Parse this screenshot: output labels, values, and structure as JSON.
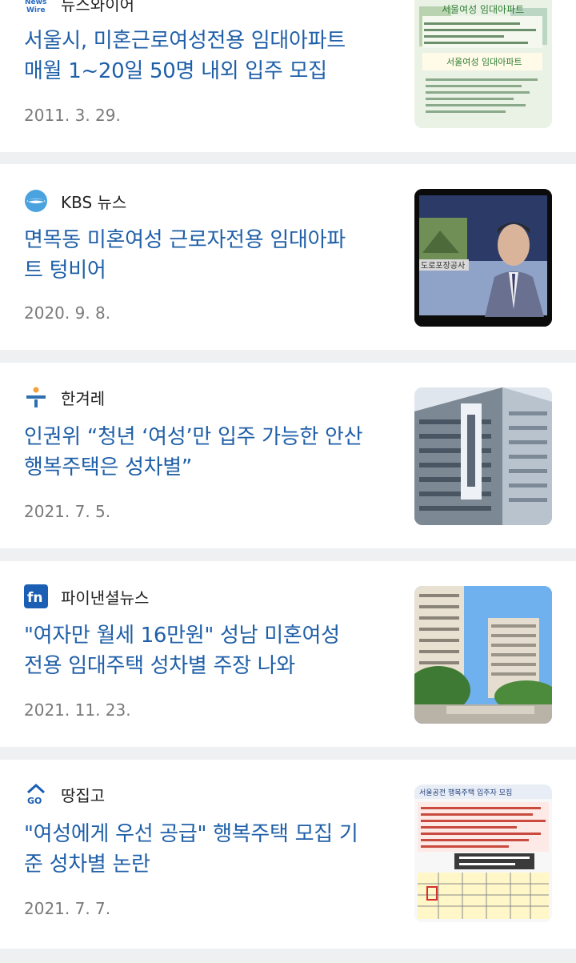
{
  "articles": [
    {
      "source": "뉴스와이어",
      "logo": "newswire-logo",
      "logo_text": "News Wire",
      "title_line1": "서울시, 미혼근로여성전용 임대아파트",
      "title_line2": "매월 1~20일 50명 내외 입주 모집",
      "date": "2011. 3. 29.",
      "thumb_text": "서울여성 임대아파트",
      "thumb_text2": "서울여성 임대아파트"
    },
    {
      "source": "KBS 뉴스",
      "logo": "kbs-logo",
      "title_line1": "면목동 미혼여성 근로자전용 임대아파",
      "title_line2": "트 텅비어",
      "date": "2020. 9. 8.",
      "thumb_text": "도로포장공사"
    },
    {
      "source": "한겨레",
      "logo": "hankyoreh-logo",
      "title_line1": "인권위 “청년 ‘여성’만 입주 가능한 안산",
      "title_line2": "행복주택은 성차별”",
      "date": "2021. 7. 5."
    },
    {
      "source": "파이낸셜뉴스",
      "logo": "fn-logo",
      "logo_text": "fn",
      "title_line1": "\"여자만 월세 16만원\" 성남 미혼여성",
      "title_line2": "전용 임대주택 성차별 주장 나와",
      "date": "2021. 11. 23."
    },
    {
      "source": "땅집고",
      "logo": "ttangjipgo-logo",
      "logo_text": "GO",
      "title_line1": "\"여성에게 우선 공급\" 행복주택 모집 기",
      "title_line2": "준 성차별 논란",
      "date": "2021. 7. 7.",
      "thumb_text": "서울공전 행복주택 입주자 모집"
    }
  ],
  "colors": {
    "title": "#1f5fa8",
    "date": "#7a7a7a",
    "separator": "#eef0f2",
    "fn_blue": "#1a5fb4",
    "hani_orange": "#f3a23b",
    "hani_blue": "#2e6fb0"
  }
}
